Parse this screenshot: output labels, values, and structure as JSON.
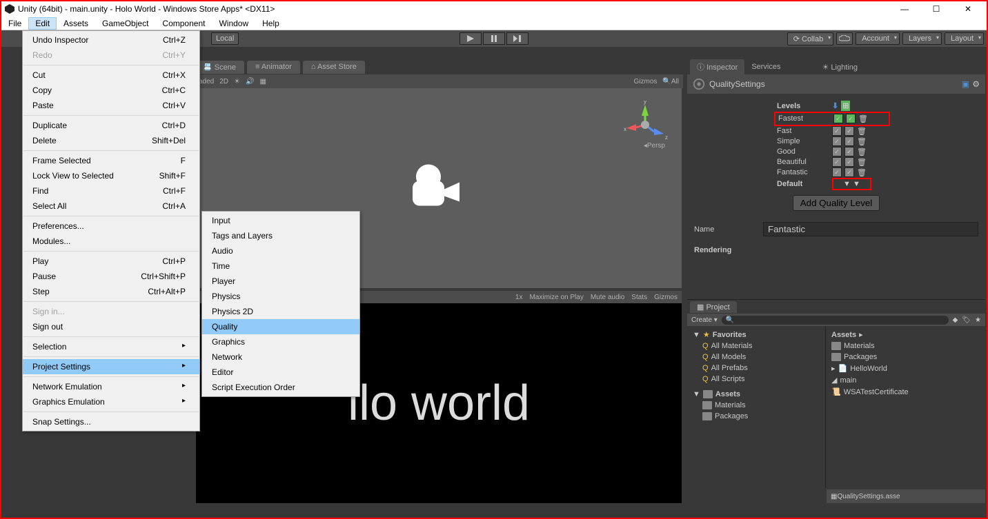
{
  "window": {
    "title": "Unity (64bit) - main.unity - Holo World - Windows Store Apps* <DX11>"
  },
  "menubar": {
    "items": [
      "File",
      "Edit",
      "Assets",
      "GameObject",
      "Component",
      "Window",
      "Help"
    ],
    "active_index": 1
  },
  "edit_menu": {
    "items": [
      {
        "label": "Undo Inspector",
        "shortcut": "Ctrl+Z"
      },
      {
        "label": "Redo",
        "shortcut": "Ctrl+Y",
        "disabled": true
      },
      {
        "sep": true
      },
      {
        "label": "Cut",
        "shortcut": "Ctrl+X"
      },
      {
        "label": "Copy",
        "shortcut": "Ctrl+C"
      },
      {
        "label": "Paste",
        "shortcut": "Ctrl+V"
      },
      {
        "sep": true
      },
      {
        "label": "Duplicate",
        "shortcut": "Ctrl+D"
      },
      {
        "label": "Delete",
        "shortcut": "Shift+Del"
      },
      {
        "sep": true
      },
      {
        "label": "Frame Selected",
        "shortcut": "F"
      },
      {
        "label": "Lock View to Selected",
        "shortcut": "Shift+F"
      },
      {
        "label": "Find",
        "shortcut": "Ctrl+F"
      },
      {
        "label": "Select All",
        "shortcut": "Ctrl+A"
      },
      {
        "sep": true
      },
      {
        "label": "Preferences..."
      },
      {
        "label": "Modules..."
      },
      {
        "sep": true
      },
      {
        "label": "Play",
        "shortcut": "Ctrl+P"
      },
      {
        "label": "Pause",
        "shortcut": "Ctrl+Shift+P"
      },
      {
        "label": "Step",
        "shortcut": "Ctrl+Alt+P"
      },
      {
        "sep": true
      },
      {
        "label": "Sign in...",
        "disabled": true
      },
      {
        "label": "Sign out"
      },
      {
        "sep": true
      },
      {
        "label": "Selection",
        "arrow": true
      },
      {
        "sep": true
      },
      {
        "label": "Project Settings",
        "arrow": true,
        "highlight": true
      },
      {
        "sep": true
      },
      {
        "label": "Network Emulation",
        "arrow": true
      },
      {
        "label": "Graphics Emulation",
        "arrow": true
      },
      {
        "sep": true
      },
      {
        "label": "Snap Settings..."
      }
    ]
  },
  "submenu": {
    "items": [
      "Input",
      "Tags and Layers",
      "Audio",
      "Time",
      "Player",
      "Physics",
      "Physics 2D",
      "Quality",
      "Graphics",
      "Network",
      "Editor",
      "Script Execution Order"
    ],
    "highlight_index": 7
  },
  "toolbar": {
    "local": "Local",
    "collab": "Collab",
    "account": "Account",
    "layers": "Layers",
    "layout": "Layout"
  },
  "scene_tabs": {
    "scene": "Scene",
    "animator": "Animator",
    "asset_store": "Asset Store"
  },
  "scene_toolbar": {
    "shaded": "aded",
    "twod": "2D",
    "gizmos": "Gizmos",
    "all": "All"
  },
  "scene": {
    "persp": "Persp",
    "axes": {
      "x": "x",
      "y": "y",
      "z": "z"
    }
  },
  "game_bar": {
    "scale": "1x",
    "maximize": "Maximize on Play",
    "mute": "Mute audio",
    "stats": "Stats",
    "gizmos": "Gizmos"
  },
  "game_view": {
    "text": "llo world"
  },
  "inspector": {
    "tabs": {
      "inspector": "Inspector",
      "services": "Services",
      "lighting": "Lighting"
    },
    "title": "QualitySettings",
    "levels_label": "Levels",
    "levels": [
      "Fastest",
      "Fast",
      "Simple",
      "Good",
      "Beautiful",
      "Fantastic"
    ],
    "default_label": "Default",
    "add_btn": "Add Quality Level",
    "name_label": "Name",
    "name_value": "Fantastic",
    "rendering_label": "Rendering"
  },
  "project": {
    "tab": "Project",
    "create": "Create",
    "favorites": "Favorites",
    "fav_items": [
      "All Materials",
      "All Models",
      "All Prefabs",
      "All Scripts"
    ],
    "assets": "Assets",
    "assets_items": [
      "Materials",
      "Packages"
    ],
    "right_header": "Assets",
    "right_items": [
      "Materials",
      "Packages",
      "HelloWorld",
      "main",
      "WSATestCertificate"
    ],
    "footer": "QualitySettings.asse"
  }
}
